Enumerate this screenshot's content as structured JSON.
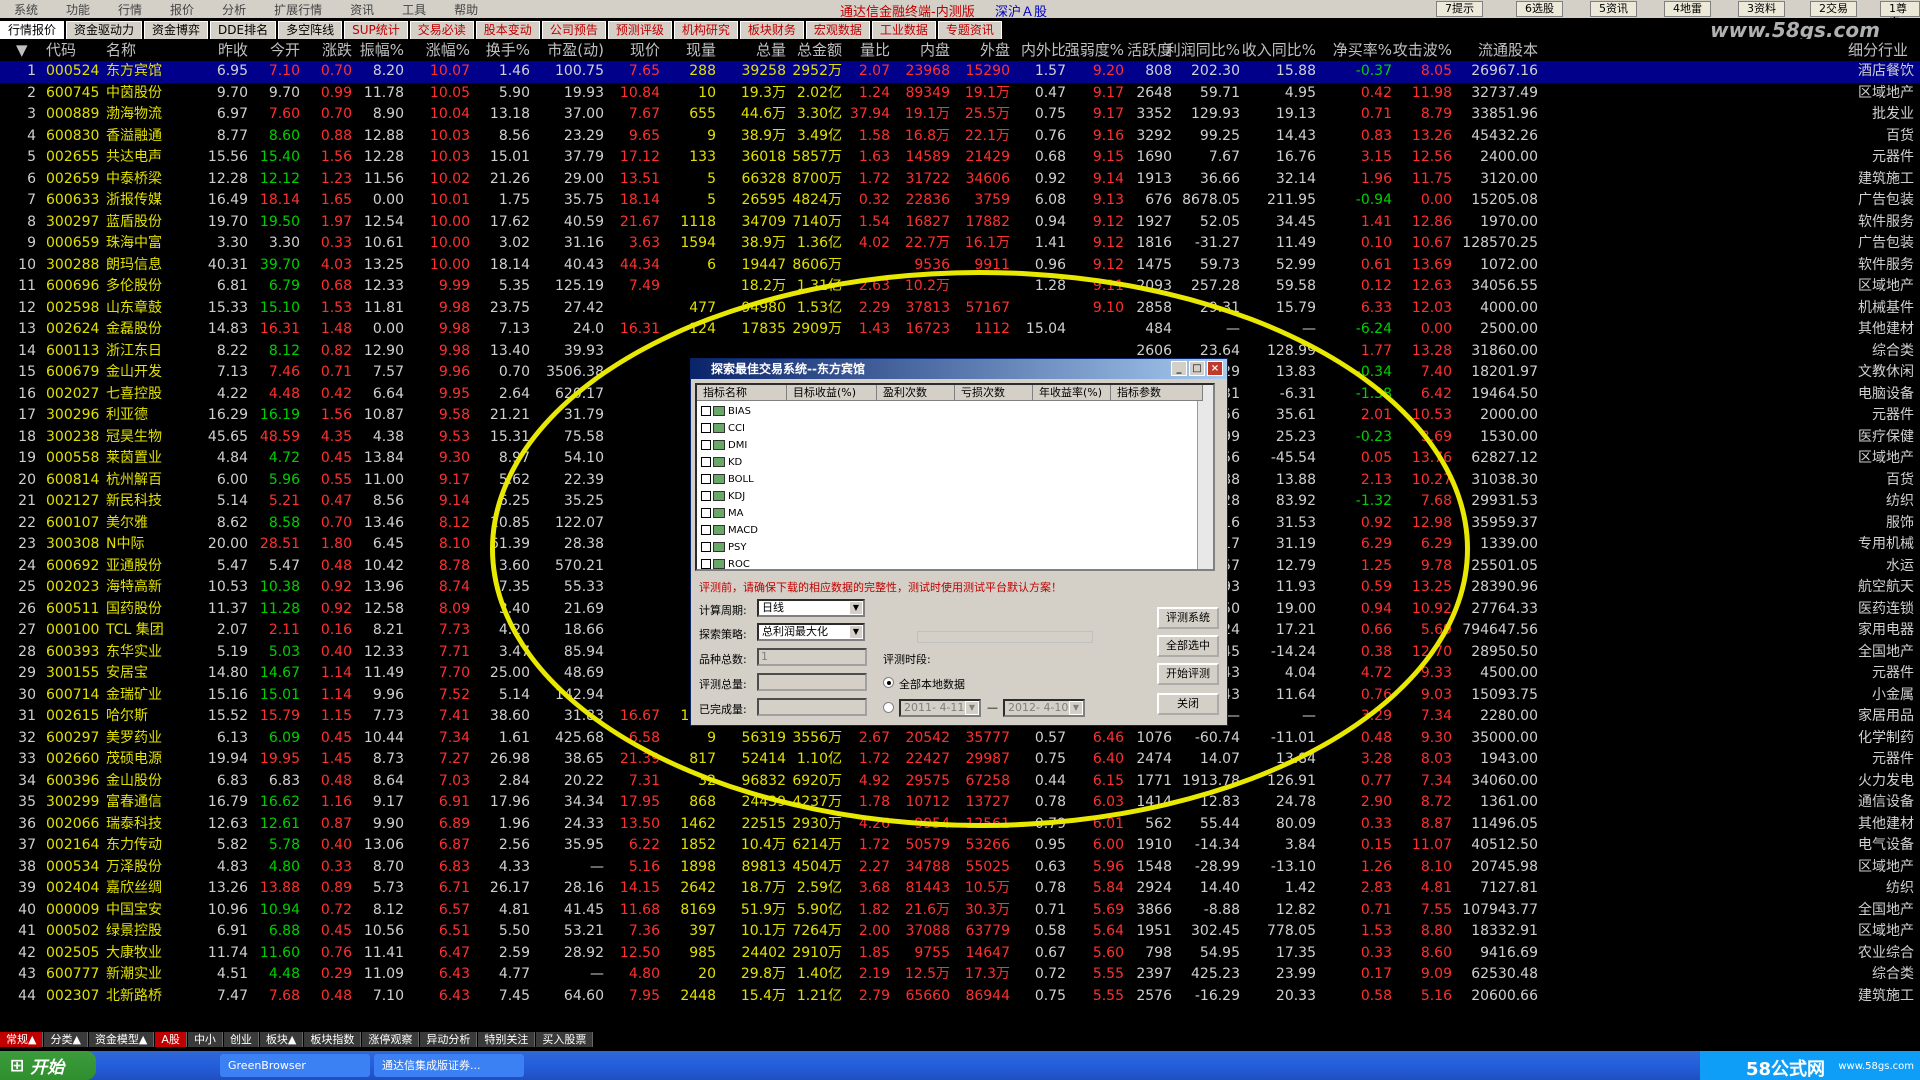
{
  "menubar": {
    "menus": [
      "系统",
      "功能",
      "行情",
      "报价",
      "分析",
      "扩展行情",
      "资讯",
      "工具",
      "帮助"
    ],
    "app_title": "通达信金融终端-内测版",
    "market": "深沪Ａ股",
    "quick": [
      "7提示",
      "6选股",
      "5资讯",
      "4地雷",
      "3资料",
      "2交易",
      "1尊富"
    ]
  },
  "tabs": [
    {
      "label": "行情报价",
      "red": false,
      "active": true
    },
    {
      "label": "资金驱动力",
      "red": false
    },
    {
      "label": "资金博弈",
      "red": false
    },
    {
      "label": "DDE排名",
      "red": false
    },
    {
      "label": "多空阵线",
      "red": false
    },
    {
      "label": "SUP统计",
      "red": true
    },
    {
      "label": "交易必读",
      "red": true
    },
    {
      "label": "股本变动",
      "red": true
    },
    {
      "label": "公司预告",
      "red": true
    },
    {
      "label": "预测评级",
      "red": true
    },
    {
      "label": "机构研究",
      "red": true
    },
    {
      "label": "板块财务",
      "red": true
    },
    {
      "label": "宏观数据",
      "red": true
    },
    {
      "label": "工业数据",
      "red": true
    },
    {
      "label": "专题资讯",
      "red": true
    }
  ],
  "watermark": "www.58gs.com",
  "columns": [
    "代码",
    "名称",
    "昨收",
    "今开",
    "涨跌",
    "振幅%",
    "涨幅%",
    "换手%",
    "市盈(动)",
    "现价",
    "现量",
    "总量",
    "总金额",
    "量比",
    "内盘",
    "外盘",
    "内外比",
    "强弱度%",
    "活跃度",
    "利润同比%",
    "收入同比%",
    "净买率%",
    "攻击波%",
    "流通股本",
    "细分行业"
  ],
  "rows": [
    [
      "1",
      "000524",
      "东方宾馆",
      "6.95",
      "7.10",
      "0.70",
      "8.20",
      "10.07",
      "1.46",
      "100.75",
      "7.65",
      "288",
      "39258",
      "2952万",
      "2.07",
      "23968",
      "15290",
      "1.57",
      "9.20",
      "808",
      "202.30",
      "15.88",
      "-0.37",
      "8.05",
      "26967.16",
      "酒店餐饮"
    ],
    [
      "2",
      "600745",
      "中茵股份",
      "9.70",
      "9.70",
      "0.99",
      "11.78",
      "10.05",
      "5.90",
      "19.93",
      "10.84",
      "10",
      "19.3万",
      "2.02亿",
      "1.24",
      "89349",
      "19.1万",
      "0.47",
      "9.17",
      "2648",
      "59.71",
      "4.95",
      "0.42",
      "11.98",
      "32737.49",
      "区域地产"
    ],
    [
      "3",
      "000889",
      "渤海物流",
      "6.97",
      "7.60",
      "0.70",
      "8.90",
      "10.04",
      "13.18",
      "37.00",
      "7.67",
      "655",
      "44.6万",
      "3.30亿",
      "37.94",
      "19.1万",
      "25.5万",
      "0.75",
      "9.17",
      "3352",
      "129.93",
      "19.13",
      "0.71",
      "8.79",
      "33851.96",
      "批发业"
    ],
    [
      "4",
      "600830",
      "香溢融通",
      "8.77",
      "8.60",
      "0.88",
      "12.88",
      "10.03",
      "8.56",
      "23.29",
      "9.65",
      "9",
      "38.9万",
      "3.49亿",
      "1.58",
      "16.8万",
      "22.1万",
      "0.76",
      "9.16",
      "3292",
      "99.25",
      "14.43",
      "0.83",
      "13.26",
      "45432.26",
      "百货"
    ],
    [
      "5",
      "002655",
      "共达电声",
      "15.56",
      "15.40",
      "1.56",
      "12.28",
      "10.03",
      "15.01",
      "37.79",
      "17.12",
      "133",
      "36018",
      "5857万",
      "1.63",
      "14589",
      "21429",
      "0.68",
      "9.15",
      "1690",
      "7.67",
      "16.76",
      "3.15",
      "12.56",
      "2400.00",
      "元器件"
    ],
    [
      "6",
      "002659",
      "中泰桥梁",
      "12.28",
      "12.12",
      "1.23",
      "11.56",
      "10.02",
      "21.26",
      "29.00",
      "13.51",
      "5",
      "66328",
      "8700万",
      "1.72",
      "31722",
      "34606",
      "0.92",
      "9.14",
      "1913",
      "36.66",
      "32.14",
      "1.96",
      "11.75",
      "3120.00",
      "建筑施工"
    ],
    [
      "7",
      "600633",
      "浙报传媒",
      "16.49",
      "18.14",
      "1.65",
      "0.00",
      "10.01",
      "1.75",
      "35.75",
      "18.14",
      "5",
      "26595",
      "4824万",
      "0.32",
      "22836",
      "3759",
      "6.08",
      "9.13",
      "676",
      "8678.05",
      "211.95",
      "-0.94",
      "0.00",
      "15205.08",
      "广告包装"
    ],
    [
      "8",
      "300297",
      "蓝盾股份",
      "19.70",
      "19.50",
      "1.97",
      "12.54",
      "10.00",
      "17.62",
      "40.59",
      "21.67",
      "1118",
      "34709",
      "7140万",
      "1.54",
      "16827",
      "17882",
      "0.94",
      "9.12",
      "1927",
      "52.05",
      "34.45",
      "1.41",
      "12.86",
      "1970.00",
      "软件服务"
    ],
    [
      "9",
      "000659",
      "珠海中富",
      "3.30",
      "3.30",
      "0.33",
      "10.61",
      "10.00",
      "3.02",
      "31.16",
      "3.63",
      "1594",
      "38.9万",
      "1.36亿",
      "4.02",
      "22.7万",
      "16.1万",
      "1.41",
      "9.12",
      "1816",
      "-31.27",
      "11.49",
      "0.10",
      "10.67",
      "128570.25",
      "广告包装"
    ],
    [
      "10",
      "300288",
      "朗玛信息",
      "40.31",
      "39.70",
      "4.03",
      "13.25",
      "10.00",
      "18.14",
      "40.43",
      "44.34",
      "6",
      "19447",
      "8606万",
      "",
      "9536",
      "9911",
      "0.96",
      "9.12",
      "1475",
      "59.73",
      "52.99",
      "0.61",
      "13.69",
      "1072.00",
      "软件服务"
    ],
    [
      "11",
      "600696",
      "多伦股份",
      "6.81",
      "6.79",
      "0.68",
      "12.33",
      "9.99",
      "5.35",
      "125.19",
      "7.49",
      "",
      "18.2万",
      "1.31亿",
      "2.63",
      "10.2万",
      "",
      "1.28",
      "9.11",
      "2093",
      "257.28",
      "59.58",
      "0.12",
      "12.63",
      "34056.55",
      "区域地产"
    ],
    [
      "12",
      "002598",
      "山东章鼓",
      "15.33",
      "15.10",
      "1.53",
      "11.81",
      "9.98",
      "23.75",
      "27.42",
      "",
      "477",
      "94980",
      "1.53亿",
      "2.29",
      "37813",
      "57167",
      "",
      "9.10",
      "2858",
      "29.31",
      "15.79",
      "6.33",
      "12.03",
      "4000.00",
      "机械基件"
    ],
    [
      "13",
      "002624",
      "金磊股份",
      "14.83",
      "16.31",
      "1.48",
      "0.00",
      "9.98",
      "7.13",
      "24.0",
      "16.31",
      "124",
      "17835",
      "2909万",
      "1.43",
      "16723",
      "1112",
      "15.04",
      "",
      "484",
      "—",
      "—",
      "-6.24",
      "0.00",
      "2500.00",
      "其他建材"
    ],
    [
      "14",
      "600113",
      "浙江东日",
      "8.22",
      "8.12",
      "0.82",
      "12.90",
      "9.98",
      "13.40",
      "39.93",
      "",
      "",
      "",
      "",
      "",
      "",
      "",
      "",
      "",
      "2606",
      "23.64",
      "128.99",
      "1.77",
      "13.28",
      "31860.00",
      "综合类"
    ],
    [
      "15",
      "600679",
      "金山开发",
      "7.13",
      "7.46",
      "0.71",
      "7.57",
      "9.96",
      "0.70",
      "3506.38",
      "",
      "",
      "",
      "",
      "",
      "",
      "",
      "",
      "",
      "2095",
      "-79.29",
      "13.83",
      "-0.34",
      "7.40",
      "18201.97",
      "文教休闲"
    ],
    [
      "16",
      "002027",
      "七喜控股",
      "4.22",
      "4.48",
      "0.42",
      "6.64",
      "9.95",
      "2.64",
      "620.17",
      "",
      "",
      "",
      "",
      "",
      "",
      "",
      "",
      "",
      "948",
      "-20.31",
      "-6.31",
      "-1.38",
      "6.42",
      "19464.50",
      "电脑设备"
    ],
    [
      "17",
      "300296",
      "利亚德",
      "16.29",
      "16.19",
      "1.56",
      "10.87",
      "9.58",
      "21.21",
      "31.79",
      "",
      "",
      "",
      "",
      "",
      "",
      "",
      "",
      "",
      "1869",
      "34.56",
      "35.61",
      "2.01",
      "10.53",
      "2000.00",
      "元器件"
    ],
    [
      "18",
      "300238",
      "冠昊生物",
      "45.65",
      "48.59",
      "4.35",
      "4.38",
      "9.53",
      "15.31",
      "75.58",
      "",
      "",
      "",
      "",
      "",
      "",
      "",
      "",
      "",
      "1745",
      "24.99",
      "25.23",
      "-0.23",
      "3.69",
      "1530.00",
      "医疗保健"
    ],
    [
      "19",
      "000558",
      "莱茵置业",
      "4.84",
      "4.72",
      "0.45",
      "13.84",
      "9.30",
      "8.97",
      "54.10",
      "",
      "",
      "",
      "",
      "",
      "",
      "",
      "",
      "",
      "3555",
      "63.56",
      "-45.54",
      "0.05",
      "13.76",
      "62827.12",
      "区域地产"
    ],
    [
      "20",
      "600814",
      "杭州解百",
      "6.00",
      "5.96",
      "0.55",
      "11.00",
      "9.17",
      "5.62",
      "22.39",
      "",
      "",
      "",
      "",
      "",
      "",
      "",
      "",
      "",
      "1604",
      "17.88",
      "13.88",
      "2.13",
      "10.27",
      "31038.30",
      "百货"
    ],
    [
      "21",
      "002127",
      "新民科技",
      "5.14",
      "5.21",
      "0.47",
      "8.56",
      "9.14",
      "6.25",
      "35.25",
      "",
      "",
      "",
      "",
      "",
      "",
      "",
      "",
      "",
      "1987",
      "-48.28",
      "83.92",
      "-1.32",
      "7.68",
      "29931.53",
      "纺织"
    ],
    [
      "22",
      "600107",
      "美尔雅",
      "8.62",
      "8.58",
      "0.70",
      "13.46",
      "8.12",
      "10.85",
      "122.07",
      "",
      "",
      "",
      "",
      "",
      "",
      "",
      "",
      "",
      "3250",
      "48.16",
      "31.53",
      "0.92",
      "12.98",
      "35959.37",
      "服饰"
    ],
    [
      "23",
      "300308",
      "N中际",
      "20.00",
      "28.51",
      "1.80",
      "6.45",
      "8.10",
      "61.39",
      "28.38",
      "",
      "",
      "",
      "",
      "",
      "",
      "",
      "",
      "",
      "771",
      "22.17",
      "31.19",
      "6.29",
      "6.29",
      "1339.00",
      "专用机械"
    ],
    [
      "24",
      "600692",
      "亚通股份",
      "5.47",
      "5.47",
      "0.48",
      "10.42",
      "8.78",
      "3.60",
      "570.21",
      "",
      "",
      "",
      "",
      "",
      "",
      "",
      "",
      "",
      "1367",
      "2025.57",
      "12.79",
      "1.25",
      "9.78",
      "25501.05",
      "水运"
    ],
    [
      "25",
      "002023",
      "海特高新",
      "10.53",
      "10.38",
      "0.92",
      "13.96",
      "8.74",
      "7.35",
      "55.33",
      "",
      "",
      "",
      "",
      "",
      "",
      "",
      "",
      "",
      "3005",
      "4.93",
      "11.93",
      "0.59",
      "13.25",
      "28390.96",
      "航空航天"
    ],
    [
      "26",
      "600511",
      "国药股份",
      "11.37",
      "11.28",
      "0.92",
      "12.58",
      "8.09",
      "3.40",
      "21.69",
      "",
      "",
      "",
      "",
      "",
      "",
      "",
      "",
      "",
      "1457",
      "-12.50",
      "19.00",
      "0.94",
      "10.92",
      "27764.33",
      "医药连锁"
    ],
    [
      "27",
      "000100",
      "TCL 集团",
      "2.07",
      "2.11",
      "0.16",
      "8.21",
      "7.73",
      "4.20",
      "18.66",
      "",
      "",
      "",
      "",
      "",
      "",
      "",
      "",
      "",
      "4625",
      "134.24",
      "17.21",
      "0.66",
      "5.69",
      "794647.56",
      "家用电器"
    ],
    [
      "28",
      "600393",
      "东华实业",
      "5.19",
      "5.03",
      "0.40",
      "12.33",
      "7.71",
      "3.47",
      "85.94",
      "",
      "",
      "",
      "",
      "",
      "",
      "",
      "",
      "",
      "1447",
      "-63.45",
      "-14.24",
      "0.38",
      "12.70",
      "28950.50",
      "全国地产"
    ],
    [
      "29",
      "300155",
      "安居宝",
      "14.80",
      "14.67",
      "1.14",
      "11.49",
      "7.70",
      "25.00",
      "48.69",
      "",
      "",
      "",
      "",
      "",
      "",
      "",
      "",
      "",
      "2838",
      "-6.43",
      "4.04",
      "4.72",
      "9.33",
      "4500.00",
      "元器件"
    ],
    [
      "30",
      "600714",
      "金瑞矿业",
      "15.16",
      "15.01",
      "1.14",
      "9.96",
      "7.52",
      "5.14",
      "142.94",
      "",
      "",
      "",
      "",
      "",
      "",
      "",
      "",
      "",
      "2269",
      "-10.43",
      "11.64",
      "0.76",
      "9.03",
      "15093.75",
      "小金属"
    ],
    [
      "31",
      "002615",
      "哈尔斯",
      "15.52",
      "15.79",
      "1.15",
      "7.73",
      "7.41",
      "38.60",
      "31.83",
      "16.67",
      "1140",
      "88008",
      "1.42亿",
      "7.33",
      "35723",
      "52285",
      "0.68",
      "",
      "2524",
      "—",
      "—",
      "3.29",
      "7.34",
      "2280.00",
      "家居用品"
    ],
    [
      "32",
      "600297",
      "美罗药业",
      "6.13",
      "6.09",
      "0.45",
      "10.44",
      "7.34",
      "1.61",
      "425.68",
      "6.58",
      "9",
      "56319",
      "3556万",
      "2.67",
      "20542",
      "35777",
      "0.57",
      "6.46",
      "1076",
      "-60.74",
      "-11.01",
      "0.48",
      "9.30",
      "35000.00",
      "化学制药"
    ],
    [
      "33",
      "002660",
      "茂硕电源",
      "19.94",
      "19.95",
      "1.45",
      "8.73",
      "7.27",
      "26.98",
      "38.65",
      "21.39",
      "817",
      "52414",
      "1.10亿",
      "1.72",
      "22427",
      "29987",
      "0.75",
      "6.40",
      "2474",
      "14.07",
      "13.84",
      "3.28",
      "8.03",
      "1943.00",
      "元器件"
    ],
    [
      "34",
      "600396",
      "金山股份",
      "6.83",
      "6.83",
      "0.48",
      "8.64",
      "7.03",
      "2.84",
      "20.22",
      "7.31",
      "32",
      "96832",
      "6920万",
      "4.92",
      "29575",
      "67258",
      "0.44",
      "6.15",
      "1771",
      "1913.78",
      "126.91",
      "0.77",
      "7.34",
      "34060.00",
      "火力发电"
    ],
    [
      "35",
      "300299",
      "富春通信",
      "16.79",
      "16.62",
      "1.16",
      "9.17",
      "6.91",
      "17.96",
      "34.34",
      "17.95",
      "868",
      "24439",
      "4237万",
      "1.78",
      "10712",
      "13727",
      "0.78",
      "6.03",
      "1414",
      "12.83",
      "24.78",
      "2.90",
      "8.72",
      "1361.00",
      "通信设备"
    ],
    [
      "36",
      "002066",
      "瑞泰科技",
      "12.63",
      "12.61",
      "0.87",
      "9.90",
      "6.89",
      "1.96",
      "24.33",
      "13.50",
      "1462",
      "22515",
      "2930万",
      "4.26",
      "9954",
      "12561",
      "0.79",
      "6.01",
      "562",
      "55.44",
      "80.09",
      "0.33",
      "8.87",
      "11496.05",
      "其他建材"
    ],
    [
      "37",
      "002164",
      "东力传动",
      "5.82",
      "5.78",
      "0.40",
      "13.06",
      "6.87",
      "2.56",
      "35.95",
      "6.22",
      "1852",
      "10.4万",
      "6214万",
      "1.72",
      "50579",
      "53266",
      "0.95",
      "6.00",
      "1910",
      "-14.34",
      "3.84",
      "0.15",
      "11.07",
      "40512.50",
      "电气设备"
    ],
    [
      "38",
      "000534",
      "万泽股份",
      "4.83",
      "4.80",
      "0.33",
      "8.70",
      "6.83",
      "4.33",
      "—",
      "5.16",
      "1898",
      "89813",
      "4504万",
      "2.27",
      "34788",
      "55025",
      "0.63",
      "5.96",
      "1548",
      "-28.99",
      "-13.10",
      "1.26",
      "8.10",
      "20745.98",
      "区域地产"
    ],
    [
      "39",
      "002404",
      "嘉欣丝绸",
      "13.26",
      "13.88",
      "0.89",
      "5.73",
      "6.71",
      "26.17",
      "28.16",
      "14.15",
      "2642",
      "18.7万",
      "2.59亿",
      "3.68",
      "81443",
      "10.5万",
      "0.78",
      "5.84",
      "2924",
      "14.40",
      "1.42",
      "2.83",
      "4.81",
      "7127.81",
      "纺织"
    ],
    [
      "40",
      "000009",
      "中国宝安",
      "10.96",
      "10.94",
      "0.72",
      "8.12",
      "6.57",
      "4.81",
      "41.45",
      "11.68",
      "8169",
      "51.9万",
      "5.90亿",
      "1.82",
      "21.6万",
      "30.3万",
      "0.71",
      "5.69",
      "3866",
      "-8.88",
      "12.82",
      "0.71",
      "7.55",
      "107943.77",
      "全国地产"
    ],
    [
      "41",
      "000502",
      "绿景控股",
      "6.91",
      "6.88",
      "0.45",
      "10.56",
      "6.51",
      "5.50",
      "53.21",
      "7.36",
      "397",
      "10.1万",
      "7264万",
      "2.00",
      "37088",
      "63779",
      "0.58",
      "5.64",
      "1951",
      "302.45",
      "778.05",
      "1.53",
      "8.80",
      "18332.91",
      "区域地产"
    ],
    [
      "42",
      "002505",
      "大康牧业",
      "11.74",
      "11.60",
      "0.76",
      "11.41",
      "6.47",
      "2.59",
      "28.92",
      "12.50",
      "985",
      "24402",
      "2910万",
      "1.85",
      "9755",
      "14647",
      "0.67",
      "5.60",
      "798",
      "54.95",
      "17.35",
      "0.33",
      "8.60",
      "9416.69",
      "农业综合"
    ],
    [
      "43",
      "600777",
      "新潮实业",
      "4.51",
      "4.48",
      "0.29",
      "11.09",
      "6.43",
      "4.77",
      "—",
      "4.80",
      "20",
      "29.8万",
      "1.40亿",
      "2.19",
      "12.5万",
      "17.3万",
      "0.72",
      "5.55",
      "2397",
      "425.23",
      "23.99",
      "0.17",
      "9.09",
      "62530.48",
      "综合类"
    ],
    [
      "44",
      "002307",
      "北新路桥",
      "7.47",
      "7.68",
      "0.48",
      "7.10",
      "6.43",
      "7.45",
      "64.60",
      "7.95",
      "2448",
      "15.4万",
      "1.21亿",
      "2.79",
      "65660",
      "86944",
      "0.75",
      "5.55",
      "2576",
      "-16.29",
      "20.33",
      "0.58",
      "5.16",
      "20600.66",
      "建筑施工"
    ]
  ],
  "dialog": {
    "title": "探索最佳交易系统--东方宾馆",
    "list_headers": [
      "指标名称",
      "目标收益(%)",
      "盈利次数",
      "亏损次数",
      "年收益率(%)",
      "指标参数"
    ],
    "indicators": [
      "BIAS",
      "CCI",
      "DMI",
      "KD",
      "BOLL",
      "KDJ",
      "MA",
      "MACD",
      "PSY",
      "ROC"
    ],
    "warning": "评测前，请确保下载的相应数据的完整性，测试时使用测试平台默认方案！",
    "period_label": "计算周期:",
    "period_value": "日线",
    "strategy_label": "探索策略:",
    "strategy_value": "总利润最大化",
    "total_label": "品种总数:",
    "total_value": "1",
    "eval_total_label": "评测总量:",
    "done_label": "已完成量:",
    "time_label": "评测时段:",
    "all_data_label": "全部本地数据",
    "date_from": "2011- 4-11",
    "date_sep": "—",
    "date_to": "2012- 4-10",
    "buttons": [
      "评测系统",
      "全部选中",
      "开始评测",
      "关闭"
    ]
  },
  "bottom_tabs": [
    "常规▲",
    "分类▲",
    "资金模型▲",
    "A股",
    "中小",
    "创业",
    "板块▲",
    "板块指数",
    "涨停观察",
    "异动分析",
    "特别关注",
    "买入股票"
  ],
  "taskbar": {
    "start": "开始",
    "tasks": [
      "GreenBrowser",
      "通达信集成版证券..."
    ],
    "brand": "58公式网",
    "url": "www.58gs.com"
  }
}
